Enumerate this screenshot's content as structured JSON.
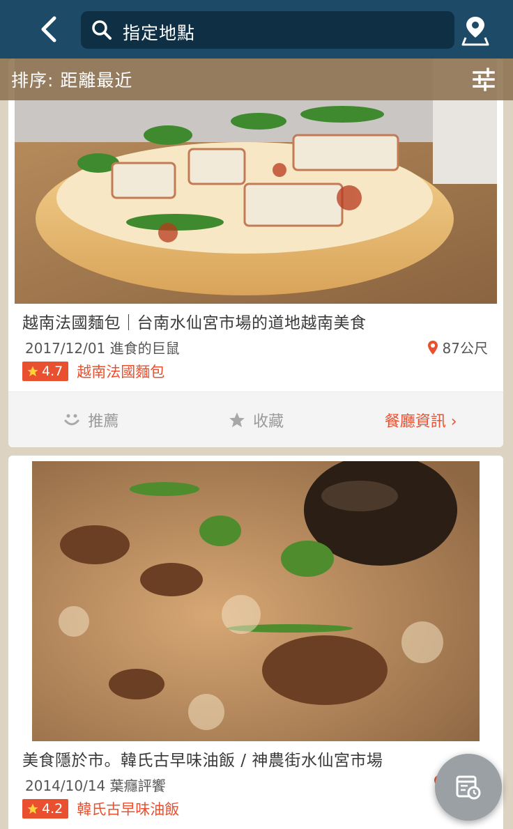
{
  "header": {
    "back_icon": "chevron-left-icon",
    "search_text": "指定地點",
    "search_icon": "search-icon",
    "map_icon": "map-pin-icon"
  },
  "sort": {
    "label": "排序: 距離最近",
    "filter_icon": "sliders-icon"
  },
  "posts": [
    {
      "title": "越南法國麵包｜台南水仙宮市場的道地越南美食",
      "date_author": "2017/12/01 進食的巨鼠",
      "distance": "87公尺",
      "rating": "4.7",
      "restaurant": "越南法國麵包"
    },
    {
      "title": "美食隱於市。韓氏古早味油飯 / 神農街水仙宮市場",
      "date_author": "2014/10/14 葉癮評饗",
      "rating": "4.2",
      "restaurant": "韓氏古早味油飯"
    }
  ],
  "actions": {
    "recommend": "推薦",
    "favorite": "收藏",
    "restaurant_info": "餐廳資訊 ›"
  },
  "colors": {
    "header_bg": "#1d4a66",
    "accent": "#e9502f",
    "page_bg": "#ddd3c3"
  },
  "fab_icon": "history-calendar-icon"
}
